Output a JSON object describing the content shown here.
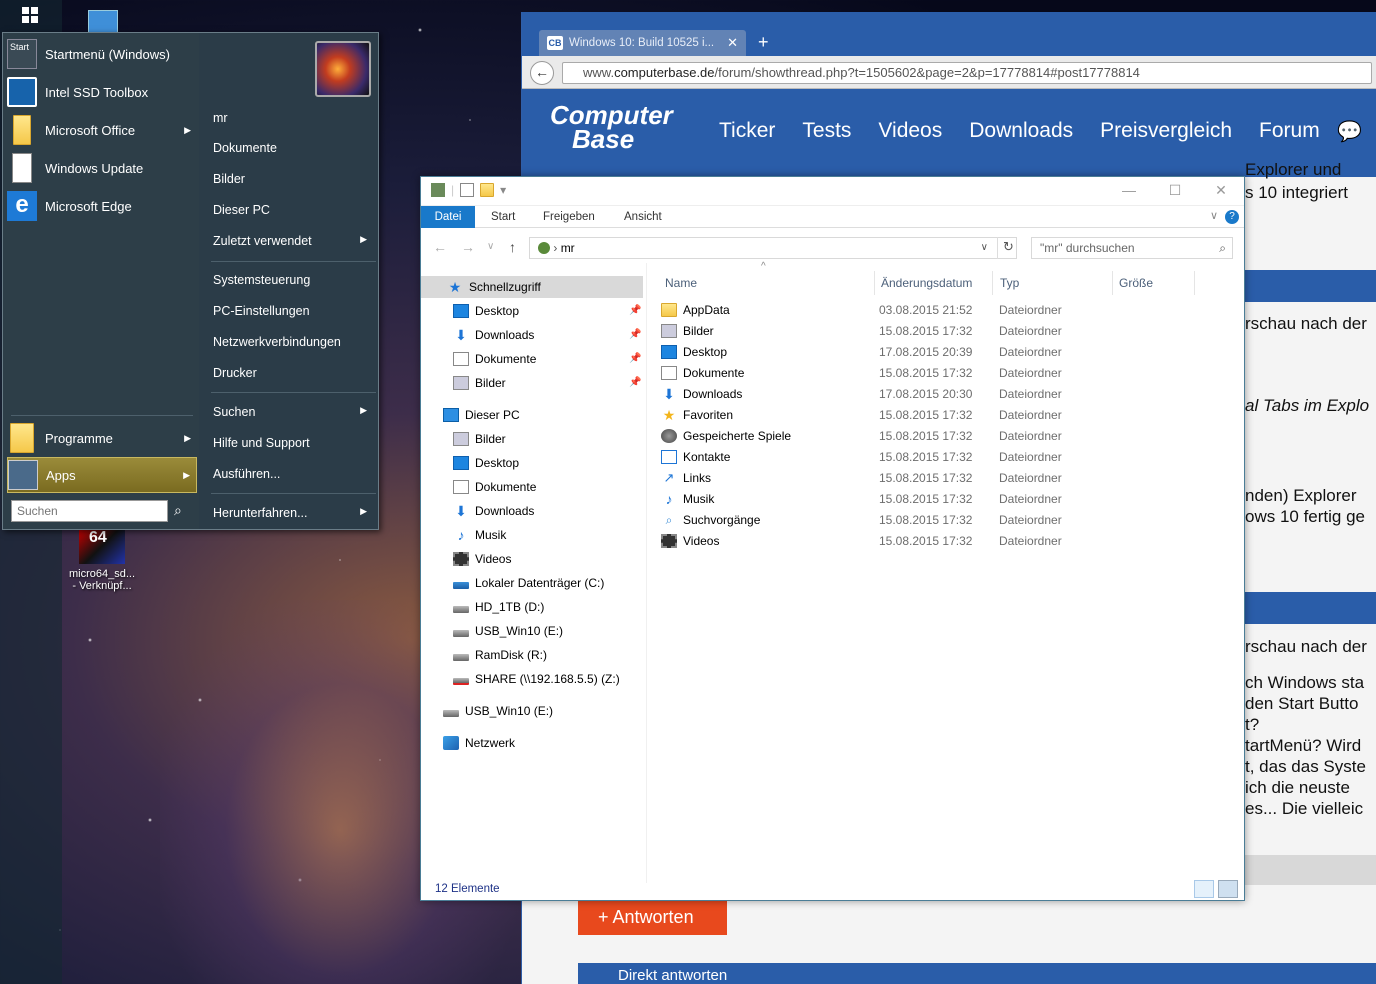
{
  "desktop": {
    "shortcut_label": "micro64_sd...\n- Verknüpf...",
    "shortcut_icon_text": "64"
  },
  "startmenu": {
    "left_items": [
      {
        "label": "Startmenü (Windows)",
        "icon": "startmenu-icon"
      },
      {
        "label": "Intel SSD Toolbox",
        "icon": "intel-icon"
      },
      {
        "label": "Microsoft Office",
        "icon": "folder-icon",
        "submenu": true
      },
      {
        "label": "Windows Update",
        "icon": "document-icon"
      },
      {
        "label": "Microsoft Edge",
        "icon": "edge-icon"
      }
    ],
    "programs_label": "Programme",
    "apps_label": "Apps",
    "search_placeholder": "Suchen",
    "right_items": [
      "mr",
      "Dokumente",
      "Bilder",
      "Dieser PC",
      "Zuletzt verwendet",
      "Systemsteuerung",
      "PC-Einstellungen",
      "Netzwerkverbindungen",
      "Drucker",
      "Suchen",
      "Hilfe und Support",
      "Ausführen...",
      "Herunterfahren..."
    ],
    "user_icon_text": "Start"
  },
  "browser": {
    "tab_title": "Windows 10: Build 10525 i...",
    "favicon_text": "CB",
    "url_prefix": "www.",
    "url_domain": "computerbase.de",
    "url_path": "/forum/showthread.php?t=1505602&page=2&p=17778814#post17778814",
    "logo_line1": "Computer",
    "logo_line2": "Base",
    "nav": [
      "Ticker",
      "Tests",
      "Videos",
      "Downloads",
      "Preisvergleich",
      "Forum"
    ],
    "snippets": [
      "Explorer   und",
      "s 10 integriert",
      "rschau nach der",
      "al Tabs im Explo",
      "nden) Explorer",
      "ows 10 fertig ge",
      "rschau nach der",
      "ch Windows sta",
      "den Start Butto",
      "t?",
      "tartMenü? Wird",
      "t, das das Syste",
      " ich die neuste",
      "es... Die vielleic"
    ],
    "reply_button": "Antworten",
    "direct_reply": "Direkt antworten"
  },
  "explorer": {
    "ribbon_tabs": [
      "Datei",
      "Start",
      "Freigeben",
      "Ansicht"
    ],
    "address_path": "mr",
    "search_placeholder": "\"mr\" durchsuchen",
    "nav": {
      "quick_access": "Schnellzugriff",
      "quick_items": [
        "Desktop",
        "Downloads",
        "Dokumente",
        "Bilder"
      ],
      "this_pc": "Dieser PC",
      "pc_items": [
        "Bilder",
        "Desktop",
        "Dokumente",
        "Downloads",
        "Musik",
        "Videos",
        "Lokaler Datenträger (C:)",
        "HD_1TB (D:)",
        "USB_Win10 (E:)",
        "RamDisk (R:)",
        "SHARE (\\\\192.168.5.5) (Z:)"
      ],
      "usb": "USB_Win10 (E:)",
      "network": "Netzwerk"
    },
    "columns": [
      "Name",
      "Änderungsdatum",
      "Typ",
      "Größe"
    ],
    "files": [
      {
        "name": "AppData",
        "date": "03.08.2015 21:52",
        "type": "Dateiordner",
        "icon": "folder-icon"
      },
      {
        "name": "Bilder",
        "date": "15.08.2015 17:32",
        "type": "Dateiordner",
        "icon": "pictures-icon"
      },
      {
        "name": "Desktop",
        "date": "17.08.2015 20:39",
        "type": "Dateiordner",
        "icon": "desktop-icon"
      },
      {
        "name": "Dokumente",
        "date": "15.08.2015 17:32",
        "type": "Dateiordner",
        "icon": "documents-icon"
      },
      {
        "name": "Downloads",
        "date": "17.08.2015 20:30",
        "type": "Dateiordner",
        "icon": "downloads-icon"
      },
      {
        "name": "Favoriten",
        "date": "15.08.2015 17:32",
        "type": "Dateiordner",
        "icon": "star-icon"
      },
      {
        "name": "Gespeicherte Spiele",
        "date": "15.08.2015 17:32",
        "type": "Dateiordner",
        "icon": "games-icon"
      },
      {
        "name": "Kontakte",
        "date": "15.08.2015 17:32",
        "type": "Dateiordner",
        "icon": "contacts-icon"
      },
      {
        "name": "Links",
        "date": "15.08.2015 17:32",
        "type": "Dateiordner",
        "icon": "link-icon"
      },
      {
        "name": "Musik",
        "date": "15.08.2015 17:32",
        "type": "Dateiordner",
        "icon": "music-icon"
      },
      {
        "name": "Suchvorgänge",
        "date": "15.08.2015 17:32",
        "type": "Dateiordner",
        "icon": "search-icon"
      },
      {
        "name": "Videos",
        "date": "15.08.2015 17:32",
        "type": "Dateiordner",
        "icon": "video-icon"
      }
    ],
    "status": "12 Elemente"
  }
}
